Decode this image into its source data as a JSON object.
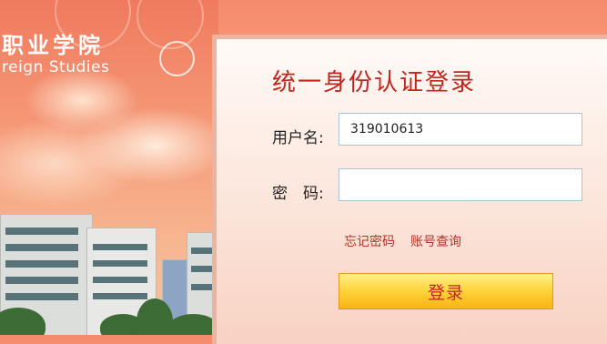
{
  "header": {
    "school_name_cn": "职业学院",
    "school_name_en": "reign Studies"
  },
  "login": {
    "title": "统一身份认证登录",
    "username_label": "用户名:",
    "username_value": "319010613",
    "password_label": "密　码:",
    "password_value": "",
    "forgot_password_link": "忘记密码",
    "account_lookup_link": "账号查询",
    "submit_label": "登录"
  },
  "colors": {
    "accent_red": "#c0261e",
    "button_yellow": "#ffd23a"
  }
}
